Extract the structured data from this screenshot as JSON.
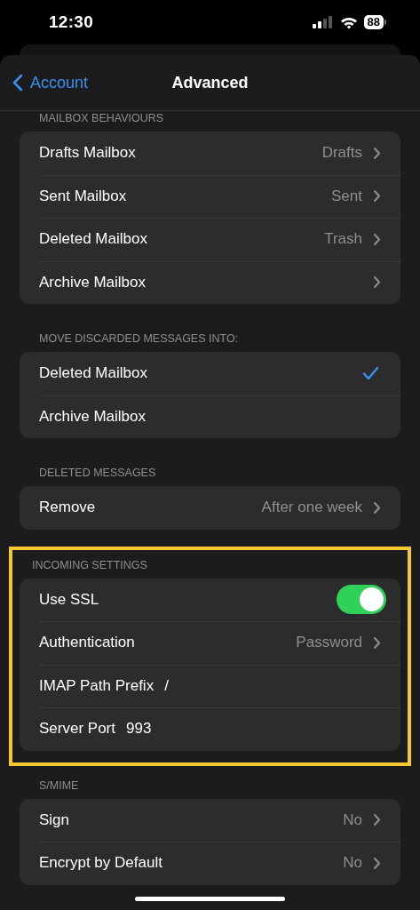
{
  "status_bar": {
    "time": "12:30",
    "battery": "88"
  },
  "nav": {
    "back": "Account",
    "title": "Advanced"
  },
  "sections": [
    {
      "header": "MAILBOX BEHAVIOURS",
      "highlighted": false,
      "rows": [
        {
          "kind": "link",
          "label": "Drafts Mailbox",
          "value": "Drafts"
        },
        {
          "kind": "link",
          "label": "Sent Mailbox",
          "value": "Sent"
        },
        {
          "kind": "link",
          "label": "Deleted Mailbox",
          "value": "Trash"
        },
        {
          "kind": "link",
          "label": "Archive Mailbox"
        }
      ]
    },
    {
      "header": "MOVE DISCARDED MESSAGES INTO:",
      "highlighted": false,
      "rows": [
        {
          "kind": "choice",
          "label": "Deleted Mailbox",
          "selected": true
        },
        {
          "kind": "choice",
          "label": "Archive Mailbox",
          "selected": false
        }
      ]
    },
    {
      "header": "DELETED MESSAGES",
      "highlighted": false,
      "rows": [
        {
          "kind": "link",
          "label": "Remove",
          "value": "After one week"
        }
      ]
    },
    {
      "header": "INCOMING SETTINGS",
      "highlighted": true,
      "rows": [
        {
          "kind": "toggle",
          "label": "Use SSL",
          "on": true
        },
        {
          "kind": "link",
          "label": "Authentication",
          "value": "Password"
        },
        {
          "kind": "field",
          "label": "IMAP Path Prefix",
          "value": "/"
        },
        {
          "kind": "field",
          "label": "Server Port",
          "value": "993"
        }
      ]
    },
    {
      "header": "S/MIME",
      "highlighted": false,
      "rows": [
        {
          "kind": "link",
          "label": "Sign",
          "value": "No"
        },
        {
          "kind": "link",
          "label": "Encrypt by Default",
          "value": "No"
        }
      ]
    }
  ]
}
